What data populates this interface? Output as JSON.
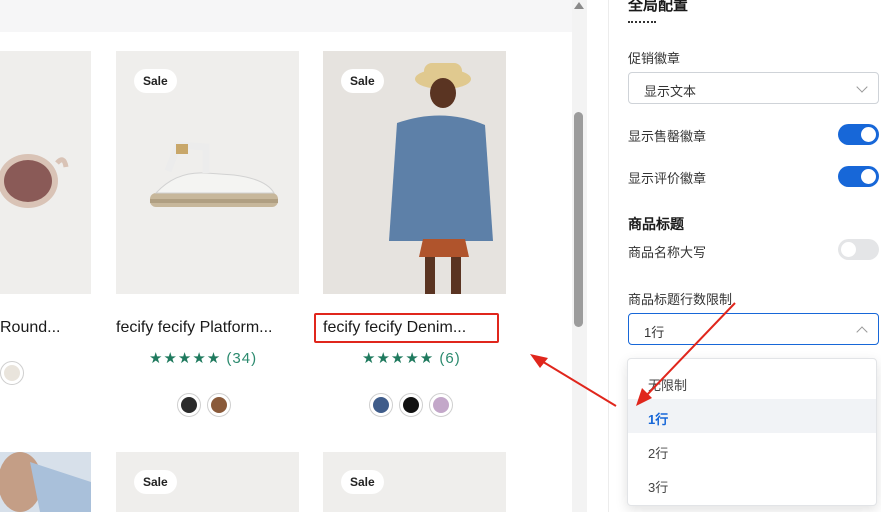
{
  "preview": {
    "products": [
      {
        "title": "Round...",
        "sale_label": "",
        "rating_stars": "",
        "rating_count": "",
        "swatches": [
          "#e9e4dc"
        ]
      },
      {
        "title": "fecify fecify Platform...",
        "sale_label": "Sale",
        "rating_stars": "★★★★★",
        "rating_count": "(34)",
        "swatches": [
          "#2b2b2b",
          "#8a5a3a"
        ]
      },
      {
        "title": "fecify fecify Denim...",
        "sale_label": "Sale",
        "rating_stars": "★★★★★",
        "rating_count": "(6)",
        "swatches": [
          "#3f5c8a",
          "#111111",
          "#c3a7c9"
        ]
      }
    ],
    "second_row": [
      {
        "sale_label": ""
      },
      {
        "sale_label": "Sale"
      },
      {
        "sale_label": "Sale"
      }
    ]
  },
  "panel": {
    "title": "全局配置",
    "promo_badge_label": "促销徽章",
    "promo_badge_value": "显示文本",
    "show_soldout_label": "显示售罄徽章",
    "show_soldout_on": true,
    "show_review_label": "显示评价徽章",
    "show_review_on": true,
    "product_title_section": "商品标题",
    "uppercase_label": "商品名称大写",
    "uppercase_on": false,
    "line_limit_label": "商品标题行数限制",
    "line_limit_value": "1行",
    "line_limit_options": [
      "无限制",
      "1行",
      "2行",
      "3行"
    ],
    "line_limit_selected_index": 1
  },
  "colors": {
    "accent": "#1767d8",
    "highlight_red": "#e0261c",
    "star_green": "#1f7a5e"
  }
}
